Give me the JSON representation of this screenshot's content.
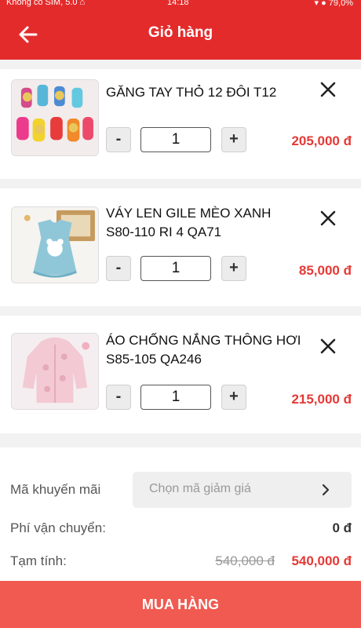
{
  "status_bar": {
    "left": "Không có SIM, 5.0 ⌂",
    "center": "14:18",
    "right": "▾ ● 79,0%"
  },
  "header": {
    "title": "Giỏ hàng"
  },
  "cart": {
    "items": [
      {
        "name": "GĂNG TAY THỎ 12 ĐÔI T12",
        "quantity": "1",
        "price": "205,000 đ",
        "minus": "-",
        "plus": "+"
      },
      {
        "name": "VÁY LEN GILE MÈO XANH S80-110 RI 4 QA71",
        "quantity": "1",
        "price": "85,000 đ",
        "minus": "-",
        "plus": "+"
      },
      {
        "name": "ÁO CHỐNG NẮNG THÔNG HƠI S85-105 QA246",
        "quantity": "1",
        "price": "215,000 đ",
        "minus": "-",
        "plus": "+"
      }
    ]
  },
  "summary": {
    "promo_label": "Mã khuyến mãi",
    "promo_placeholder": "Chọn mã giảm giá",
    "shipping_label": "Phí vận chuyển:",
    "shipping_value": "0 đ",
    "subtotal_label": "Tạm tính:",
    "subtotal_original": "540,000 đ",
    "subtotal_final": "540,000 đ"
  },
  "checkout": {
    "label": "MUA HÀNG"
  },
  "colors": {
    "primary": "#e42b2b",
    "price": "#e53935",
    "checkout": "#f05a50"
  }
}
